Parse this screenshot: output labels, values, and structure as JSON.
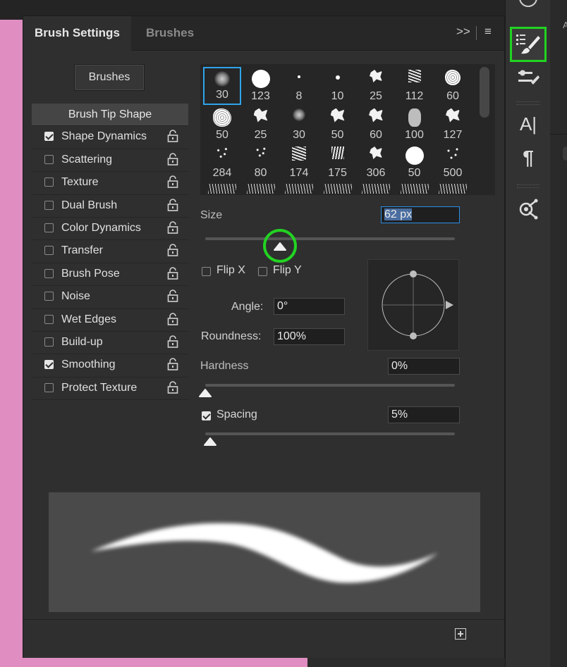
{
  "tabs": [
    {
      "label": "Brush Settings",
      "active": true
    },
    {
      "label": "Brushes",
      "active": false
    }
  ],
  "panel_controls": {
    "collapse": ">>",
    "menu": "≡"
  },
  "brushes_button": "Brushes",
  "options": {
    "header": "Brush Tip Shape",
    "items": [
      {
        "label": "Shape Dynamics",
        "checked": true
      },
      {
        "label": "Scattering",
        "checked": false
      },
      {
        "label": "Texture",
        "checked": false
      },
      {
        "label": "Dual Brush",
        "checked": false
      },
      {
        "label": "Color Dynamics",
        "checked": false
      },
      {
        "label": "Transfer",
        "checked": false
      },
      {
        "label": "Brush Pose",
        "checked": false
      },
      {
        "label": "Noise",
        "checked": false
      },
      {
        "label": "Wet Edges",
        "checked": false
      },
      {
        "label": "Build-up",
        "checked": false
      },
      {
        "label": "Smoothing",
        "checked": true
      },
      {
        "label": "Protect Texture",
        "checked": false
      }
    ]
  },
  "presets": {
    "row1": [
      "30",
      "123",
      "8",
      "10",
      "25",
      "112",
      "60"
    ],
    "row2": [
      "50",
      "25",
      "30",
      "50",
      "60",
      "100",
      "127"
    ],
    "row3": [
      "284",
      "80",
      "174",
      "175",
      "306",
      "50",
      "500"
    ],
    "selected_index": 0
  },
  "size": {
    "label": "Size",
    "value": "62 px",
    "slider_fraction": 0.3
  },
  "flip": {
    "flip_x": "Flip X",
    "flip_y": "Flip Y",
    "flip_x_checked": false,
    "flip_y_checked": false
  },
  "angle": {
    "label": "Angle:",
    "value": "0°"
  },
  "roundness": {
    "label": "Roundness:",
    "value": "100%"
  },
  "hardness": {
    "label": "Hardness",
    "value": "0%",
    "slider_fraction": 0.0
  },
  "spacing": {
    "label": "Spacing",
    "value": "5%",
    "checked": true,
    "slider_fraction": 0.02
  },
  "toolstrip": {
    "icons": [
      "brush-settings-icon",
      "brush-presets-icon",
      "character-icon",
      "paragraph-icon",
      "properties-icon"
    ],
    "character_glyph": "A|",
    "paragraph_glyph": "¶"
  },
  "right_edge": {
    "letter": "A"
  },
  "colors": {
    "highlight_green": "#22d322",
    "selection_blue": "#2ea5ea",
    "canvas_pink": "#e08ec2"
  }
}
